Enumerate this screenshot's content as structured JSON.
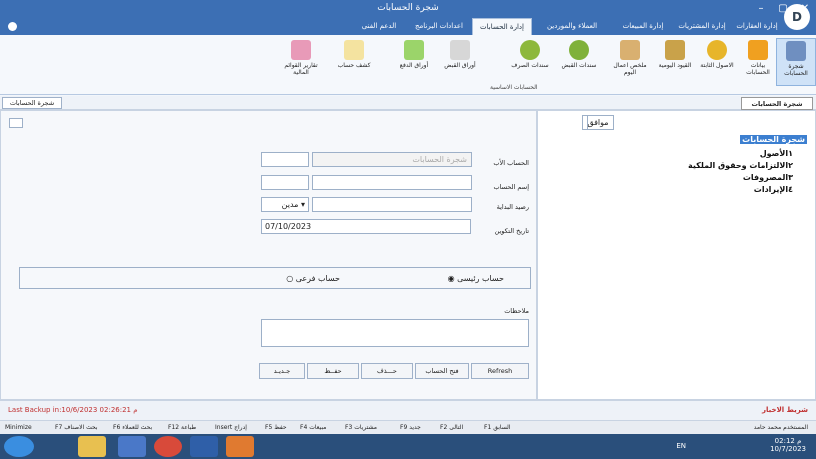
{
  "window": {
    "title": "شجرة الحسابات",
    "brand": "D"
  },
  "tabs": [
    {
      "label": "إدارة العقارات"
    },
    {
      "label": "إدارة المشتريات"
    },
    {
      "label": "إدارة المبيعات"
    },
    {
      "label": "العملاء والموردين"
    },
    {
      "label": "إدارة الحسابات",
      "active": true
    },
    {
      "label": "اعدادات البرنامج"
    },
    {
      "label": "الدعم الفنى"
    }
  ],
  "ribbon": {
    "group_label": "الحسابات الاساسية",
    "buttons": [
      {
        "label": "شجرة الحسابات",
        "icon": "tree-icon",
        "selected": true
      },
      {
        "label": "بيانات الحسابات",
        "icon": "box-icon"
      },
      {
        "label": "الاصول الثابتة",
        "icon": "globe-icon"
      },
      {
        "label": "القيود اليومية",
        "icon": "scale-icon"
      },
      {
        "label": "ملخص اعمال اليوم",
        "icon": "clipboard-icon"
      },
      {
        "label": "سندات القبض",
        "icon": "coin-in-icon"
      },
      {
        "label": "سندات الصرف",
        "icon": "coin-out-icon"
      },
      {
        "label": "أوراق القبض",
        "icon": "pen-icon"
      },
      {
        "label": "أوراق الدفع",
        "icon": "battery-icon"
      },
      {
        "label": "كشف حساب",
        "icon": "note-icon"
      },
      {
        "label": "تقارير القوائم المالية",
        "icon": "grid-icon"
      }
    ]
  },
  "pane": {
    "tab": "شجرة الحسابات",
    "tooltip": "شجرة الحسابات"
  },
  "form": {
    "parent_label": "الحساب الأب",
    "parent_value": "شجرة الحسابات",
    "name_label": "إسم الحساب",
    "opening_label": "رصيد البداية",
    "debit_option": "مدين",
    "date_label": "تاريخ التكوين",
    "date_value": "07/10/2023",
    "main_account": "حساب رئيسى",
    "sub_account": "حساب فرعى",
    "notes_label": "ملاحظات"
  },
  "buttons": {
    "refresh": "Refresh",
    "open": "فتح الحساب",
    "delete": "حـــذف",
    "save": "حفــظ",
    "new": "جـديـد",
    "ok": "موافق"
  },
  "tree": {
    "root": "شجرة الحسابات",
    "items": [
      "١الأصول",
      "٢الالتزامات وحقوق الملكية",
      "٣المصروفات",
      "٤الإيرادات"
    ]
  },
  "status": {
    "backup": "Last Backup in:10/6/2023 02:26:21 م",
    "news": "شريط الاخبار"
  },
  "fkeys": [
    "F1 السابق",
    "F2 التالى",
    "F9 جديد",
    "F3 مشتريات",
    "F4 مبيعات",
    "F5 حفظ",
    "Insert إدراج",
    "F12 طباعة",
    "F6 بحث للعملاء",
    "F7 بحث الاصناف",
    "Minimize"
  ],
  "user": {
    "label": "المستخدم",
    "name": "محمد حامد"
  },
  "taskbar": {
    "lang": "EN",
    "time": "02:12 م",
    "date": "10/7/2023",
    "start": "start-icon"
  }
}
